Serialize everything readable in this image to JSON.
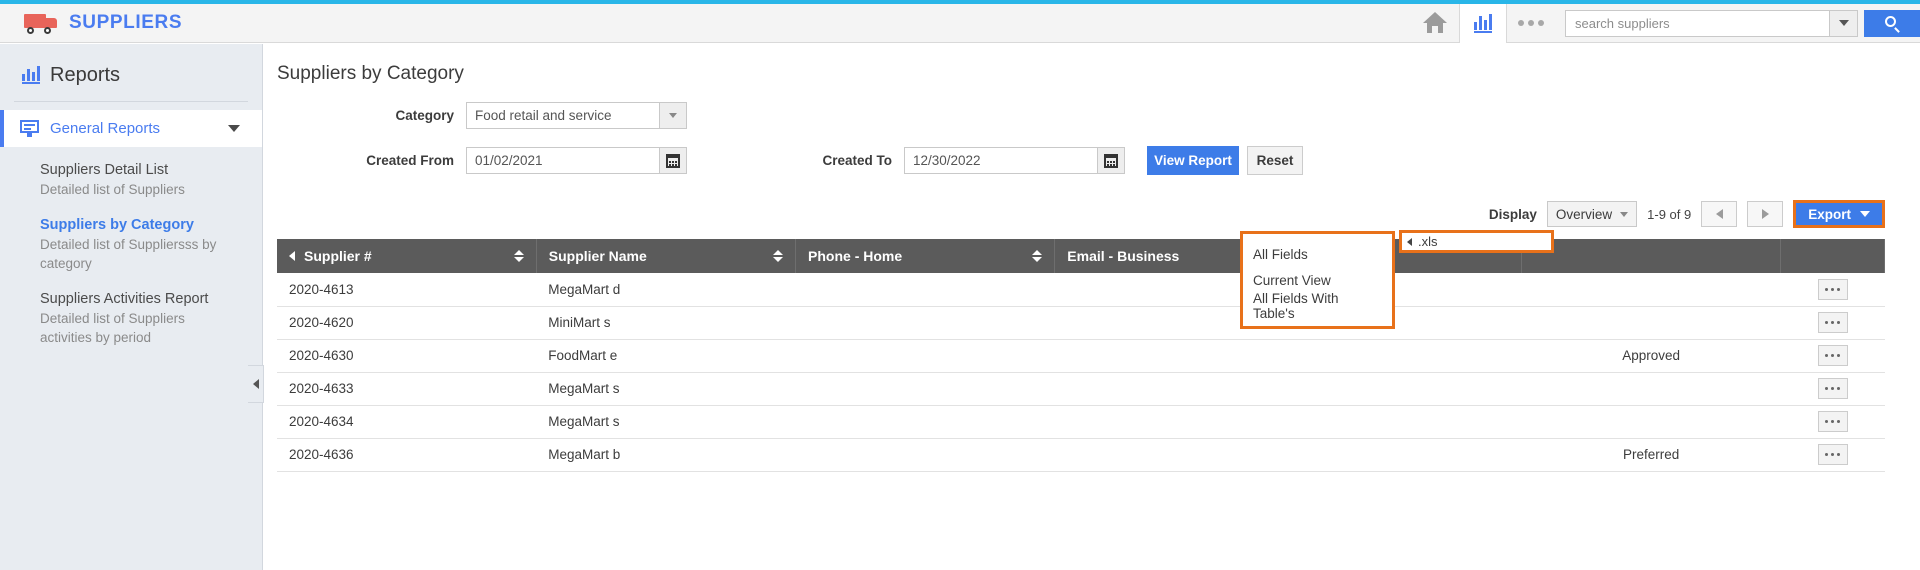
{
  "header": {
    "brand": "SUPPLIERS",
    "logo_icon": "truck-icon",
    "home_icon": "home-icon",
    "reports_icon": "bar-chart-icon",
    "more_icon": "ellipsis-icon",
    "search_value": "",
    "search_placeholder": "search suppliers",
    "search_dropdown_icon": "chevron-down-icon",
    "search_button_icon": "search-icon",
    "accent_color": "#29b6e8",
    "brand_color": "#4a7cf0"
  },
  "sidebar": {
    "title": "Reports",
    "title_icon": "bar-chart-icon",
    "group": {
      "label": "General Reports",
      "icon": "monitor-icon",
      "expanded_icon": "chevron-down-icon"
    },
    "items": [
      {
        "title": "Suppliers Detail List",
        "desc": "Detailed list of Suppliers",
        "active": false
      },
      {
        "title": "Suppliers by Category",
        "desc": "Detailed list of Suppliersss by category",
        "active": true
      },
      {
        "title": "Suppliers Activities Report",
        "desc": "Detailed list of Suppliers activities by period",
        "active": false
      }
    ],
    "collapse_icon": "chevron-left-icon"
  },
  "main": {
    "page_title": "Suppliers by Category",
    "form": {
      "category_label": "Category",
      "category_value": "Food retail and service",
      "created_from_label": "Created From",
      "created_from_value": "01/02/2021",
      "created_to_label": "Created To",
      "created_to_value": "12/30/2022",
      "calendar_icon": "calendar-icon",
      "view_report_label": "View Report",
      "reset_label": "Reset"
    },
    "toolbar": {
      "display_label": "Display",
      "display_value": "Overview",
      "display_caret_icon": "chevron-down-icon",
      "pagination": "1-9 of 9",
      "prev_icon": "chevron-left-icon",
      "next_icon": "chevron-right-icon",
      "export_label": "Export",
      "export_caret_icon": "chevron-down-icon",
      "highlight_color": "#e8711a"
    },
    "table": {
      "columns": [
        {
          "label": "Supplier #",
          "sortable": true,
          "lead_icon": "chevron-left-icon"
        },
        {
          "label": "Supplier Name",
          "sortable": true,
          "lead_icon": ""
        },
        {
          "label": "Phone - Home",
          "sortable": true,
          "lead_icon": ""
        },
        {
          "label": "Email - Business",
          "sortable": false,
          "lead_icon": ""
        }
      ],
      "rows": [
        {
          "supplier_no": "2020-4613",
          "name": "MegaMart d",
          "phone": "",
          "email": "",
          "status": "",
          "menu_icon": "ellipsis-icon"
        },
        {
          "supplier_no": "2020-4620",
          "name": "MiniMart s",
          "phone": "",
          "email": "",
          "status": "",
          "menu_icon": "ellipsis-icon"
        },
        {
          "supplier_no": "2020-4630",
          "name": "FoodMart e",
          "phone": "",
          "email": "",
          "status": "Approved",
          "menu_icon": "ellipsis-icon"
        },
        {
          "supplier_no": "2020-4633",
          "name": "MegaMart s",
          "phone": "",
          "email": "",
          "status": "",
          "menu_icon": "ellipsis-icon"
        },
        {
          "supplier_no": "2020-4634",
          "name": "MegaMart s",
          "phone": "",
          "email": "",
          "status": "",
          "menu_icon": "ellipsis-icon"
        },
        {
          "supplier_no": "2020-4636",
          "name": "MegaMart b",
          "phone": "",
          "email": "",
          "status": "Preferred",
          "menu_icon": "ellipsis-icon"
        }
      ]
    },
    "export_menu": {
      "items": [
        "All Fields",
        "Current View",
        "All Fields With Table's"
      ]
    },
    "xls_field": {
      "value": ".xls",
      "caret_icon": "chevron-left-icon"
    }
  }
}
